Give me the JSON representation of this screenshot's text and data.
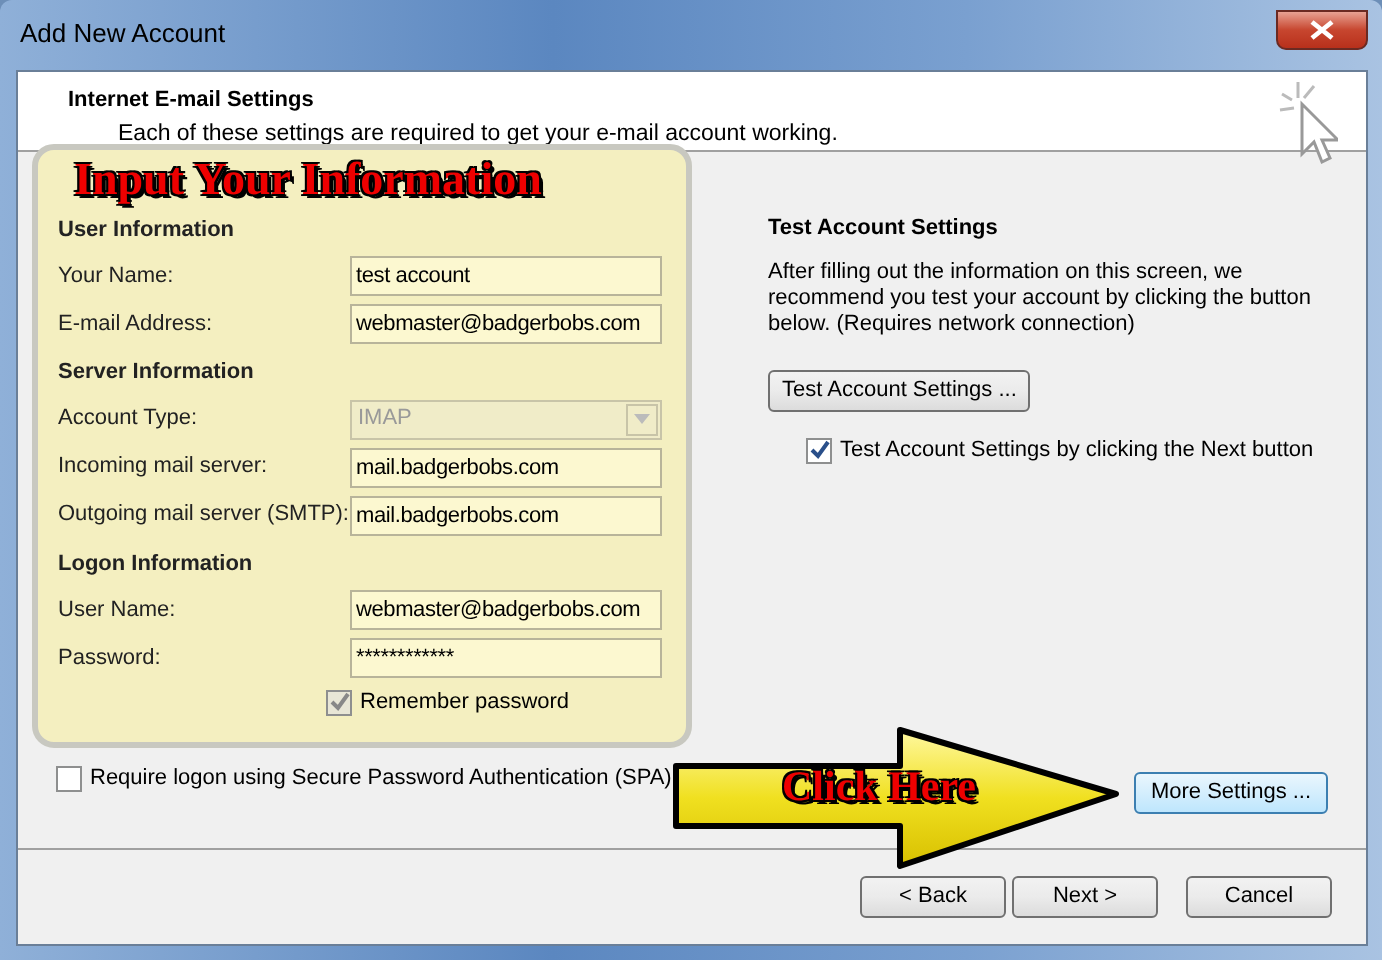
{
  "window": {
    "title": "Add New Account"
  },
  "header": {
    "title": "Internet E-mail Settings",
    "subtitle": "Each of these settings are required to get your e-mail account working."
  },
  "annotations": {
    "panel_title": "Input Your Information",
    "arrow_label": "Click Here"
  },
  "sections": [
    {
      "heading": "User Information",
      "fields": [
        {
          "label": "Your Name:",
          "value": "test account",
          "kind": "text",
          "disabled": false
        },
        {
          "label": "E-mail Address:",
          "value": "webmaster@badgerbobs.com",
          "kind": "text",
          "disabled": false
        }
      ]
    },
    {
      "heading": "Server Information",
      "fields": [
        {
          "label": "Account Type:",
          "value": "IMAP",
          "kind": "dropdown",
          "disabled": true
        },
        {
          "label": "Incoming mail server:",
          "value": "mail.badgerbobs.com",
          "kind": "text",
          "disabled": false
        },
        {
          "label": "Outgoing mail server (SMTP):",
          "value": "mail.badgerbobs.com",
          "kind": "text",
          "disabled": false
        }
      ]
    },
    {
      "heading": "Logon Information",
      "fields": [
        {
          "label": "User Name:",
          "value": "webmaster@badgerbobs.com",
          "kind": "text",
          "disabled": false
        },
        {
          "label": "Password:",
          "value": "************",
          "kind": "text",
          "disabled": false
        }
      ]
    }
  ],
  "remember_password": {
    "label": "Remember password",
    "checked": true
  },
  "spa": {
    "label": "Require logon using Secure Password Authentication (SPA)",
    "checked": false
  },
  "test_settings": {
    "heading": "Test Account Settings",
    "description": "After filling out the information on this screen, we recommend you test your account by clicking the button below. (Requires network connection)",
    "button": "Test Account Settings ...",
    "next_checkbox": {
      "label": "Test Account Settings by clicking the Next button",
      "checked": true
    }
  },
  "more_settings_button": "More Settings ...",
  "footer_buttons": [
    "< Back",
    "Next >",
    "Cancel"
  ]
}
